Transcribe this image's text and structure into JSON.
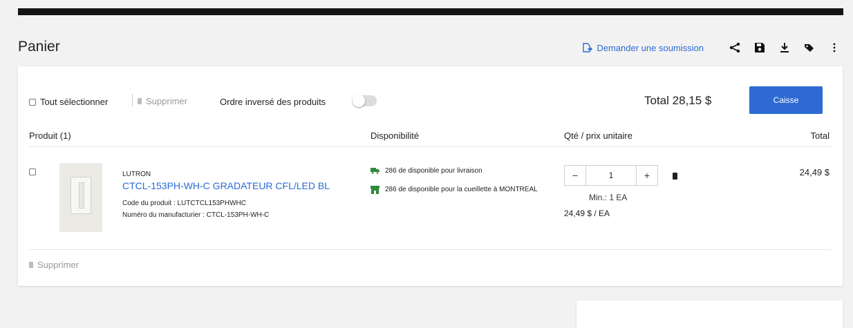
{
  "page": {
    "title": "Panier"
  },
  "header_actions": {
    "request_quote": "Demander une soumission",
    "icons": [
      "share-icon",
      "save-icon",
      "download-icon",
      "tag-icon",
      "more-vert-icon"
    ]
  },
  "toolbar": {
    "select_all": "Tout sélectionner",
    "delete": "Supprimer",
    "reverse_order": "Ordre inversé des produits",
    "reverse_order_on": false,
    "total": "Total 28,15 $",
    "checkout": "Caisse"
  },
  "columns": {
    "product": "Produit (1)",
    "availability": "Disponibilité",
    "qty_price": "Qté / prix unitaire",
    "total": "Total"
  },
  "item": {
    "brand": "LUTRON",
    "name": "CTCL-153PH-WH-C GRADATEUR CFL/LED BL",
    "product_code": "Code du produit :  LUTCTCL153PHWHC",
    "manufacturer_number": "Numéro du manufacturier : CTCL-153PH-WH-C",
    "availability_delivery": "286 de disponible pour livraison",
    "availability_pickup": "286 de disponible pour la cueillette à MONTREAL",
    "quantity": "1",
    "min_qty": "Min.: 1 EA",
    "unit_price": "24,49 $ / EA",
    "total": "24,49 $"
  },
  "footer": {
    "delete": "Supprimer"
  },
  "colors": {
    "accent": "#2d6ad3",
    "link": "#2a6ad6",
    "availability_green": "#2e8b3a",
    "muted": "#999999"
  }
}
